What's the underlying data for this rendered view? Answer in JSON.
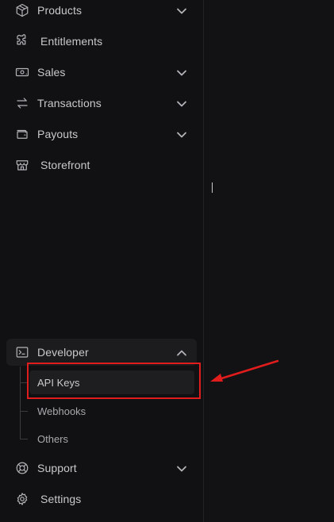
{
  "sidebar": {
    "items": [
      {
        "id": "products",
        "label": "Products",
        "icon": "box-icon",
        "has_chevron": true,
        "expanded": false
      },
      {
        "id": "entitlements",
        "label": "Entitlements",
        "icon": "puzzle-icon",
        "has_chevron": false
      },
      {
        "id": "sales",
        "label": "Sales",
        "icon": "cash-icon",
        "has_chevron": true,
        "expanded": false
      },
      {
        "id": "transactions",
        "label": "Transactions",
        "icon": "arrows-swap-icon",
        "has_chevron": true,
        "expanded": false
      },
      {
        "id": "payouts",
        "label": "Payouts",
        "icon": "wallet-icon",
        "has_chevron": true,
        "expanded": false
      },
      {
        "id": "storefront",
        "label": "Storefront",
        "icon": "store-icon",
        "has_chevron": false
      }
    ],
    "developer": {
      "label": "Developer",
      "icon": "terminal-icon",
      "expanded": true,
      "children": [
        {
          "id": "api-keys",
          "label": "API Keys",
          "selected": true
        },
        {
          "id": "webhooks",
          "label": "Webhooks",
          "selected": false
        },
        {
          "id": "others",
          "label": "Others",
          "selected": false
        }
      ]
    },
    "support": {
      "label": "Support",
      "icon": "lifebuoy-icon",
      "has_chevron": true,
      "expanded": false
    },
    "settings": {
      "label": "Settings",
      "icon": "gear-icon"
    }
  },
  "annotation": {
    "color": "#e01c1c",
    "target": "api-keys"
  },
  "colors": {
    "background": "#111113",
    "text": "#c9c9cc",
    "active_bg": "#1c1c1f"
  }
}
